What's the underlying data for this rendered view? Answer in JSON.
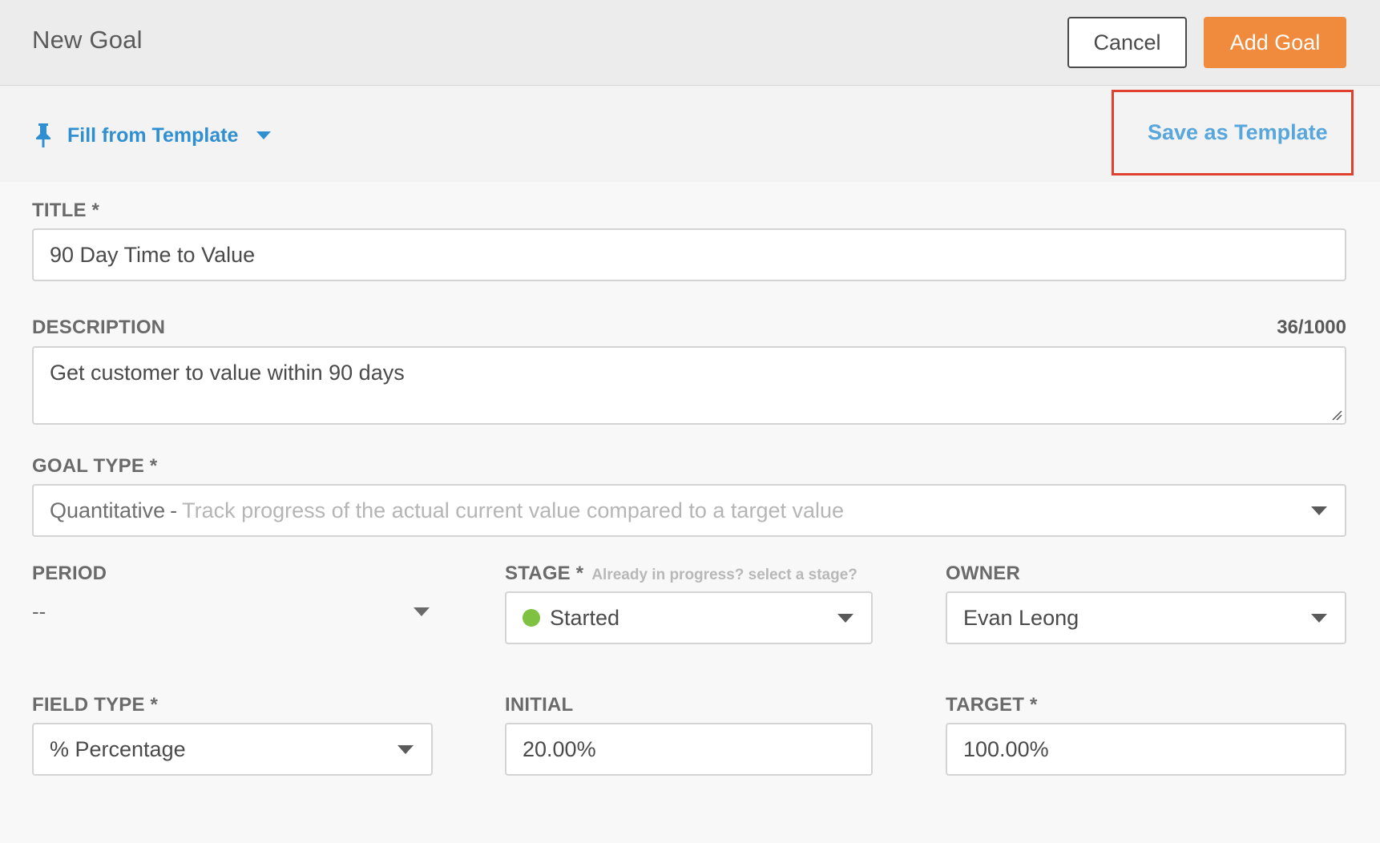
{
  "header": {
    "title": "New Goal",
    "cancel_label": "Cancel",
    "add_label": "Add Goal"
  },
  "template_bar": {
    "fill_label": "Fill from Template",
    "save_label": "Save as Template"
  },
  "form": {
    "title": {
      "label": "TITLE *",
      "value": "90 Day Time to Value"
    },
    "description": {
      "label": "DESCRIPTION",
      "counter": "36/1000",
      "value": "Get customer to value within 90 days"
    },
    "goal_type": {
      "label": "GOAL TYPE *",
      "value_main": "Quantitative",
      "value_sep": "-",
      "value_desc": "Track progress of the actual current value compared to a target value"
    },
    "period": {
      "label": "PERIOD",
      "value": "--"
    },
    "stage": {
      "label": "STAGE *",
      "hint": "Already in progress? select a stage?",
      "value": "Started",
      "status_color": "#7fc241"
    },
    "owner": {
      "label": "OWNER",
      "value": "Evan Leong"
    },
    "field_type": {
      "label": "FIELD TYPE *",
      "value": "% Percentage"
    },
    "initial": {
      "label": "INITIAL",
      "value": "20.00%"
    },
    "target": {
      "label": "TARGET *",
      "value": "100.00%"
    }
  },
  "colors": {
    "accent_orange": "#f08a3c",
    "link_blue": "#2f8fd1",
    "highlight_red": "#e0412f"
  }
}
